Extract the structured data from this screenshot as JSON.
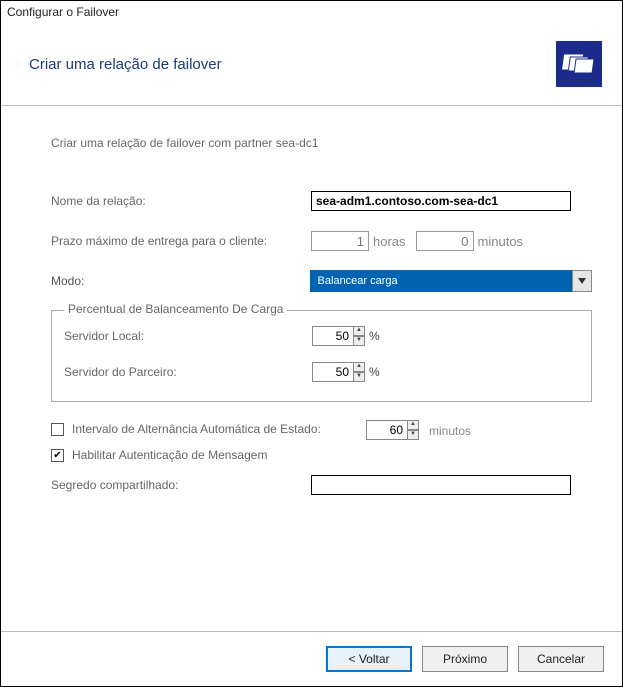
{
  "window_title": "Configurar o Failover",
  "header_title": "Criar uma relação de failover",
  "intro_text": "Criar uma relação de failover com partner sea-dc1",
  "labels": {
    "relationship_name": "Nome da relação:",
    "max_client_lead_time": "Prazo máximo de entrega para o cliente:",
    "hours_unit": "horas",
    "minutes_unit": "minutos",
    "mode": "Modo:",
    "group_title": "Percentual de Balanceamento De Carga",
    "local_server": "Servidor Local:",
    "partner_server": "Servidor do Parceiro:",
    "state_switchover": "Intervalo de Alternância Automática de Estado:",
    "state_minutes_unit": "minutos",
    "enable_message_auth": "Habilitar Autenticação de Mensagem",
    "shared_secret": "Segredo compartilhado:"
  },
  "values": {
    "relationship_name": "sea-adm1.contoso.com-sea-dc1",
    "hours": "1",
    "minutes": "0",
    "mode_selected": "Balancear carga",
    "local_pct": "50",
    "partner_pct": "50",
    "state_interval": "60",
    "shared_secret": ""
  },
  "checks": {
    "state_switchover": false,
    "enable_message_auth": true
  },
  "percent_sign": "%",
  "buttons": {
    "back": "< Voltar",
    "next": "Próximo",
    "cancel": "Cancelar"
  }
}
